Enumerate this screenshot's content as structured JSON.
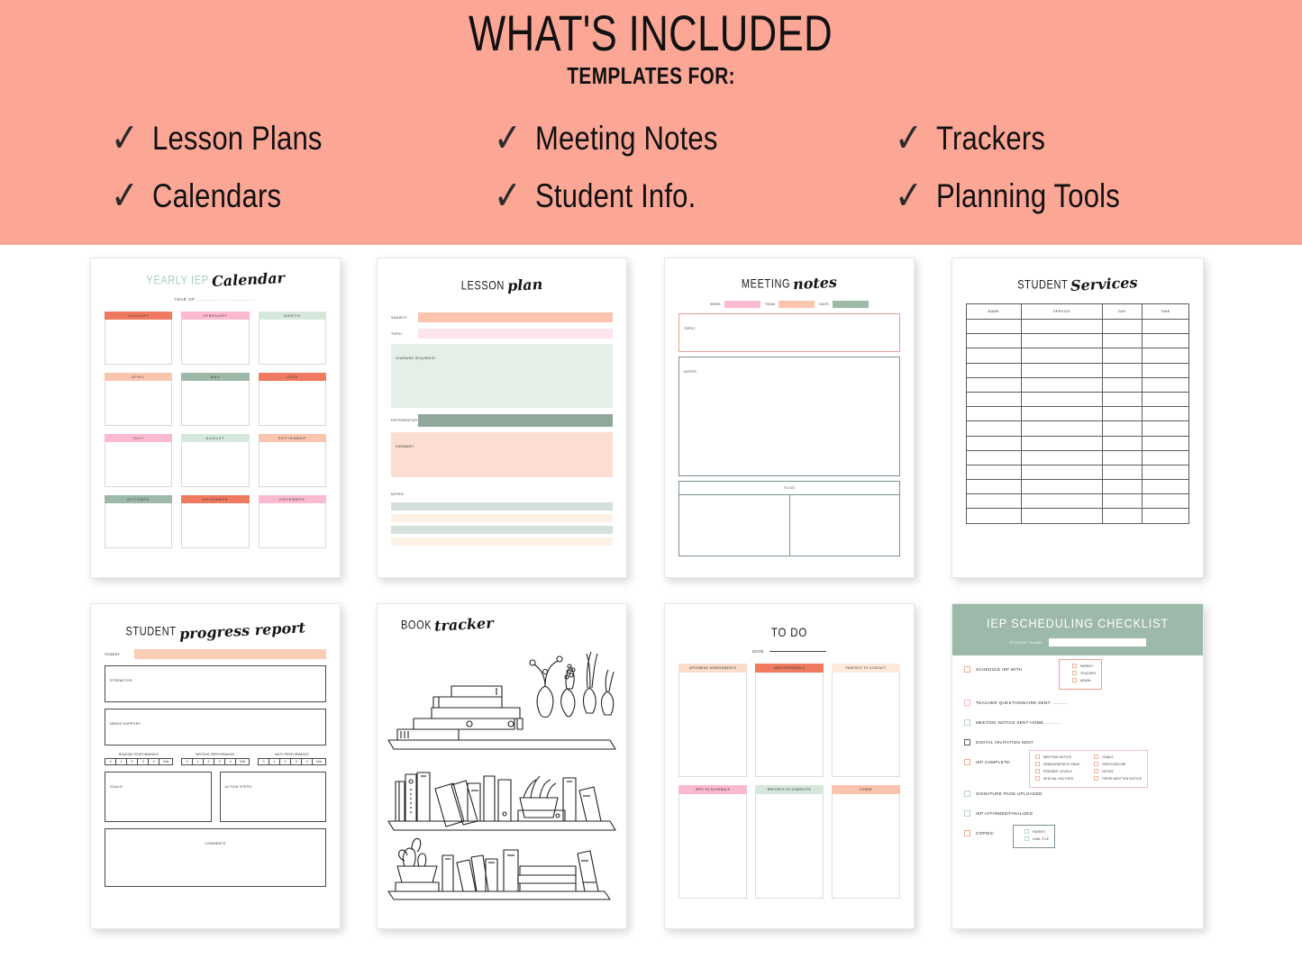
{
  "banner": {
    "title": "WHAT'S INCLUDED",
    "subtitle": "TEMPLATES FOR:",
    "check_glyph": "✓",
    "items": [
      "Lesson Plans",
      "Meeting Notes",
      "Trackers",
      "Calendars",
      "Student Info.",
      "Planning Tools"
    ],
    "bg_color": "#fca696"
  },
  "colors": {
    "coral": "#f07a5f",
    "salmon": "#fbc4ae",
    "pink": "#fbb9d2",
    "light_pink": "#fde4ee",
    "mint": "#d6e8dc",
    "sage": "#9db9a9",
    "sage_dark": "#8fa698",
    "peach": "#fbd9bf",
    "cream": "#fdf1e6",
    "pale_sage": "#d5e0da"
  },
  "templates": {
    "calendar": {
      "title_upper": "YEARLY IEP",
      "title_script": "Calendar",
      "year_label": "YEAR OF:",
      "year_dots": "............................",
      "months": [
        {
          "name": "JANUARY",
          "color": "#f07a5f"
        },
        {
          "name": "FEBRUARY",
          "color": "#fbb9d2"
        },
        {
          "name": "MARCH",
          "color": "#d6e8dc"
        },
        {
          "name": "APRIL",
          "color": "#fbc4ae"
        },
        {
          "name": "MAY",
          "color": "#9db9a9"
        },
        {
          "name": "JUNE",
          "color": "#f07a5f"
        },
        {
          "name": "JULY",
          "color": "#fbb9d2"
        },
        {
          "name": "AUGUST",
          "color": "#d6e8dc"
        },
        {
          "name": "SEPTEMBER",
          "color": "#fbc4ae"
        },
        {
          "name": "OCTOBER",
          "color": "#9db9a9"
        },
        {
          "name": "NOVEMBER",
          "color": "#f07a5f"
        },
        {
          "name": "DECEMBER",
          "color": "#fbb9d2"
        }
      ]
    },
    "lesson_plan": {
      "title_upper": "LESSON",
      "title_script": "plan",
      "fields": [
        {
          "label": "SUBJECT:",
          "color": "#fbc4ae"
        },
        {
          "label": "TOPIC:",
          "color": "#fde4ee"
        }
      ],
      "learning_sequence_label": "LEARNING SEQUENCE:",
      "learning_sequence_color": "#e5efe7",
      "differentiation_label": "DIFFERENTIATION:",
      "differentiation_color": "#90a799",
      "summary_label": "SUMMARY:",
      "summary_color": "#fbded1",
      "notes_label": "NOTES:",
      "note_row_colors": [
        "#d5e0da",
        "#fdf1e6",
        "#d5e0da",
        "#fdf1e6"
      ]
    },
    "meeting_notes": {
      "title_upper": "MEETING",
      "title_script": "notes",
      "fields": [
        {
          "label": "WEEK:",
          "color": "#fbb9d2"
        },
        {
          "label": "TEAM:",
          "color": "#fbc4ae"
        },
        {
          "label": "DATE:",
          "color": "#9db9a9"
        }
      ],
      "topic_label": "TOPIC:",
      "notes_label": "NOTES:",
      "todo_label": "TO DO"
    },
    "student_services": {
      "title_upper": "STUDENT",
      "title_script": "Services",
      "columns": [
        "NAME",
        "SERVICE",
        "DAY",
        "TIME"
      ],
      "row_count": 14
    },
    "progress_report": {
      "title_upper": "STUDENT",
      "title_script": "progress report",
      "student_label": "STUDENT:",
      "student_bar_color": "#fbcdb4",
      "strengths_label": "STRENGTHS:",
      "needs_support_label": "NEEDS SUPPORT:",
      "scales": [
        {
          "label": "READING PERFORMANCE",
          "options": [
            "0",
            "1",
            "2",
            "3",
            "4",
            "N/A"
          ]
        },
        {
          "label": "WRITING PERFORMANCE",
          "options": [
            "0",
            "1",
            "2",
            "3",
            "4",
            "N/A"
          ]
        },
        {
          "label": "MATH PERFORMANCE",
          "options": [
            "0",
            "1",
            "2",
            "3",
            "4",
            "N/A"
          ]
        }
      ],
      "goals_label": "GOALS:",
      "action_steps_label": "ACTION STEPS:",
      "comments_label": "COMMENTS"
    },
    "book_tracker": {
      "title_upper": "BOOK",
      "title_script": "tracker"
    },
    "to_do": {
      "title": "TO DO",
      "date_label": "DATE",
      "cells": [
        {
          "label": "UPCOMING ASSESSMENTS",
          "color": "#fbdccb"
        },
        {
          "label": "NEW REFERRALS",
          "color": "#f07a5f"
        },
        {
          "label": "PARENTS TO CONTACT",
          "color": "#fdeadb"
        },
        {
          "label": "IEPS TO SCHEDULE",
          "color": "#fbb9d2"
        },
        {
          "label": "REPORTS TO COMPLETE",
          "color": "#d6e8dc"
        },
        {
          "label": "OTHER",
          "color": "#fbc4ae"
        }
      ]
    },
    "iep_checklist": {
      "title": "IEP SCHEDULING CHECKLIST",
      "banner_color": "#9db9a9",
      "student_name_label": "STUDENT NAME:",
      "items": [
        {
          "label": "SCHEDULE IEP WITH",
          "box": "peach"
        },
        {
          "label": "TEACHER QUESTIONNAIRE SENT: ...........",
          "box": "pink"
        },
        {
          "label": "MEETING NOTICE SENT HOME  ...........",
          "box": "mint"
        },
        {
          "label": "DIGITAL INVITATION SENT",
          "box": "dark"
        },
        {
          "label": "IEP COMPLETE:",
          "box": "peach"
        },
        {
          "label": "SIGNATURE PAGE UPLOADED",
          "box": "mint"
        },
        {
          "label": "IEP AFFIRMED/FINALIZED",
          "box": "mint"
        },
        {
          "label": "COPIES:",
          "box": "peach"
        }
      ],
      "schedule_with": [
        "PARENT",
        "TEACHER",
        "ADMIN"
      ],
      "iep_complete_left": [
        "MEETING NOTICE",
        "DEMOGRAPHICS PAGE",
        "PRESENT LEVELS",
        "SPECIAL FACTORS"
      ],
      "iep_complete_right": [
        "GOALS",
        "SERVICES/LRE",
        "NOTES",
        "PRIOR WRITTEN NOTICE"
      ],
      "copies": [
        "PARENT",
        "CUM. FILE"
      ]
    }
  }
}
